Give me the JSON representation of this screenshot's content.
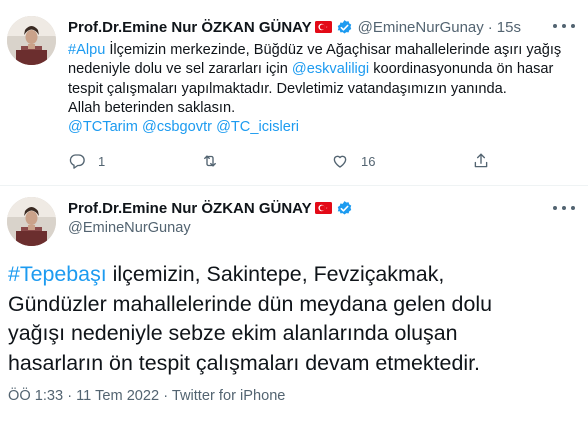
{
  "tweet1": {
    "author_name": "Prof.Dr.Emine Nur ÖZKAN GÜNAY",
    "handle": "@EmineNurGunay",
    "separator": "·",
    "time": "15s",
    "body": {
      "line1_hashtag": "#Alpu",
      "line1_text": " İlçemizin merkezinde, Büğdüz ve Ağaçhisar mahallelerinde aşırı yağış",
      "line2_pre": "nedeniyle dolu ve sel zararları için ",
      "line2_mention": "@eskvaliligi",
      "line2_post": " koordinasyonunda ön hasar",
      "line3": "tespit çalışmaları yapılmaktadır. Devletimiz vatandaşımızın yanında.",
      "line4": "Allah beterinden saklasın.",
      "mentions": [
        "@TCTarim",
        "@csbgovtr",
        "@TC_icisleri"
      ]
    },
    "actions": {
      "reply_count": "1",
      "retweet_count": "",
      "like_count": "16",
      "reply_icon": "reply-icon",
      "retweet_icon": "retweet-icon",
      "like_icon": "heart-icon",
      "share_icon": "share-icon"
    }
  },
  "tweet2": {
    "author_name": "Prof.Dr.Emine Nur ÖZKAN GÜNAY",
    "handle": "@EmineNurGunay",
    "body": {
      "hashtag": "#Tepebaşı",
      "line1_text": " ilçemizin, Sakintepe, Fevziçakmak,",
      "line2": "Gündüzler mahallelerinde dün meydana gelen dolu",
      "line3": "yağışı nedeniyle sebze ekim alanlarında oluşan",
      "line4": "hasarların ön tespit çalışmaları devam etmektedir."
    },
    "meta": "ÖÖ 1:33 · 11 Tem 2022 · Twitter for iPhone"
  },
  "colors": {
    "link": "#1d9bf0",
    "secondary_text": "#536471",
    "primary_text": "#0f1419",
    "verified": "#1d9bf0",
    "flag_red": "#e30a17"
  }
}
